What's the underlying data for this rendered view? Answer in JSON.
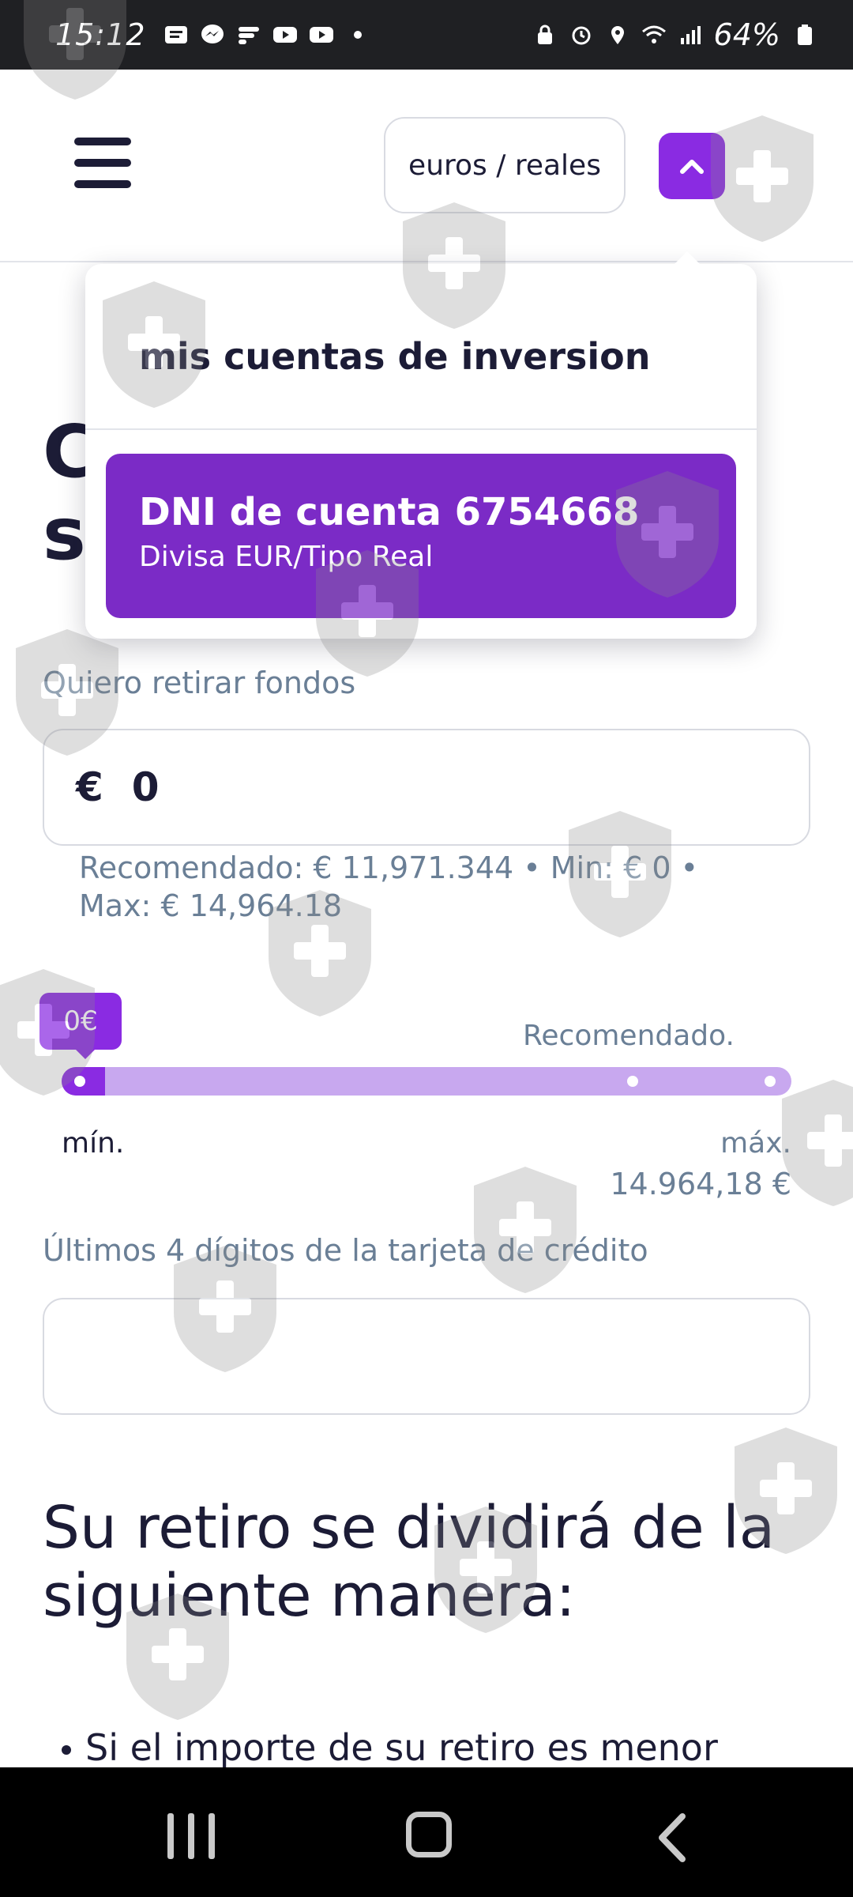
{
  "status_bar": {
    "time": "15:12",
    "battery": "64%",
    "icons": [
      "notification-icon",
      "messenger-icon",
      "drive-icon",
      "youtube-icon",
      "youtube-icon",
      "dot-icon",
      "lock-icon",
      "alarm-icon",
      "location-icon",
      "wifi-icon",
      "signal-icon",
      "battery-icon"
    ]
  },
  "header": {
    "menu_icon": "hamburger-icon",
    "currency_toggle": "euros / reales",
    "account_button_icon": "chevron-up-icon",
    "accent": "#8a2be2"
  },
  "dropdown": {
    "title": "mis cuentas de inversion",
    "accounts": [
      {
        "id_label": "DNI de cuenta 6754668",
        "subtitle": "Divisa EUR/Tipo Real"
      }
    ]
  },
  "page": {
    "heading_fragment": [
      "C",
      "s"
    ],
    "withdraw_label": "Quiero retirar fondos",
    "amount": {
      "currency_symbol": "€",
      "value": "0"
    },
    "limits_line1": "Recomendado: € 11,971.344 • Min: € 0 •",
    "limits_line2": "Max: € 14,964.18",
    "slider": {
      "current_label": "0€",
      "recommended_label": "Recomendado.",
      "min_label": "mín.",
      "max_label": "máx.",
      "max_value": "14.964,18 €",
      "fill_fraction": 0.06
    },
    "card_label": "Últimos 4 dígitos de la tarjeta de crédito",
    "card_value": "",
    "split_title_line1": "Su retiro se dividirá de la",
    "split_title_line2": "siguiente manera:",
    "bullet_text": "Si el importe de su retiro es menor"
  },
  "nav": {
    "recent_icon": "recent-apps-icon",
    "home_icon": "home-icon",
    "back_icon": "back-icon"
  }
}
